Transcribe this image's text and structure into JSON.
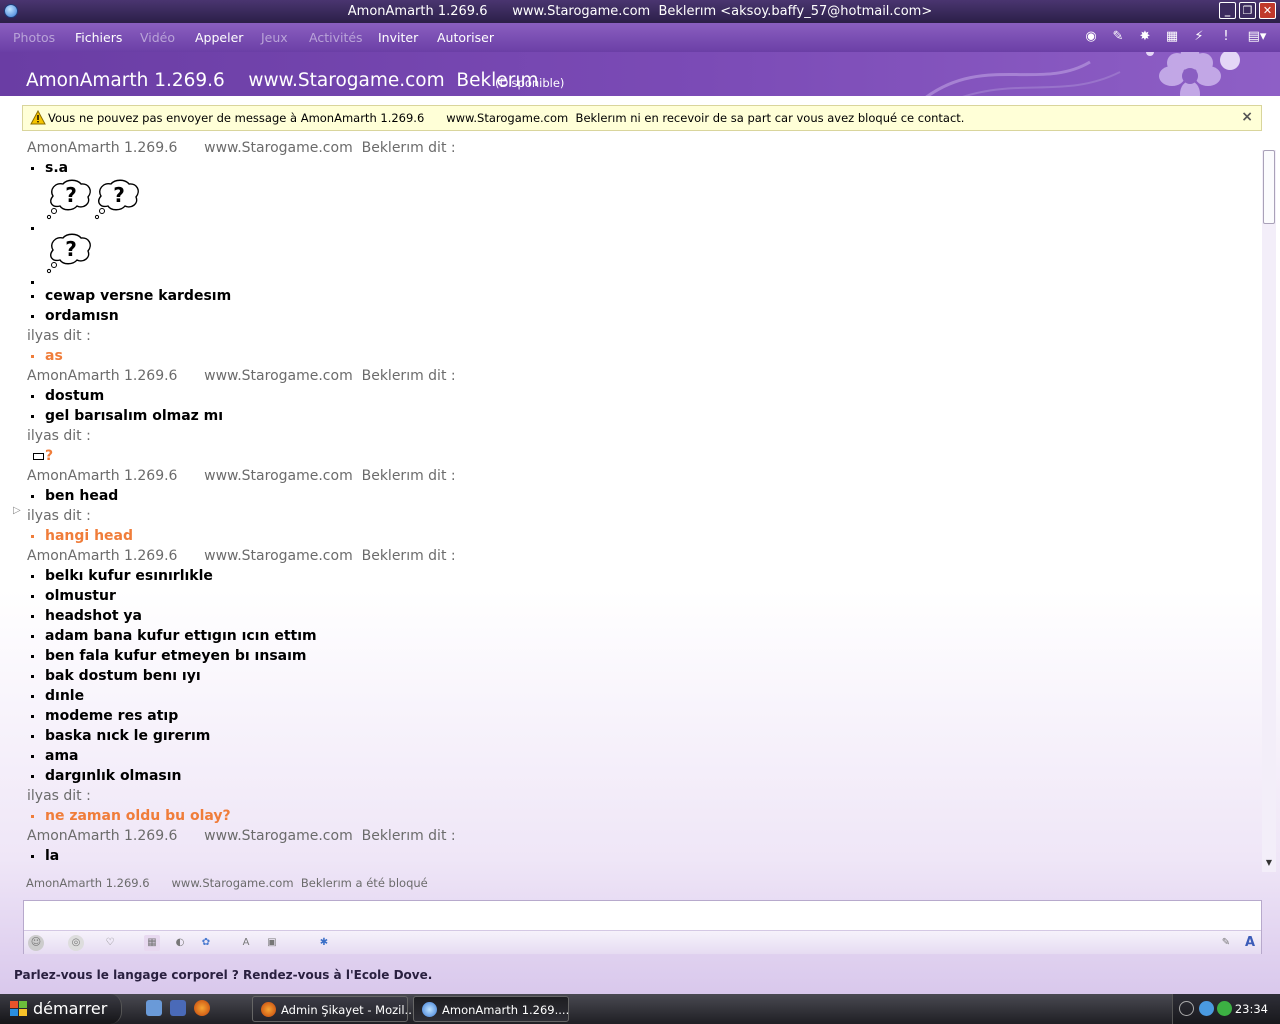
{
  "window": {
    "title": "AmonAmarth 1.269.6      www.Starogame.com  Beklerım <aksoy.baffy_57@hotmail.com>",
    "minimize": "_",
    "maximize": "❐",
    "close": "✕"
  },
  "menu": {
    "items": [
      {
        "label": "Photos",
        "enabled": false
      },
      {
        "label": "Fichiers",
        "enabled": true
      },
      {
        "label": "Vidéo",
        "enabled": false
      },
      {
        "label": "Appeler",
        "enabled": true
      },
      {
        "label": "Jeux",
        "enabled": false
      },
      {
        "label": "Activités",
        "enabled": false
      },
      {
        "label": "Inviter",
        "enabled": true
      },
      {
        "label": "Autoriser",
        "enabled": true
      }
    ],
    "toolbar_icons": [
      "games-icon",
      "paint-icon",
      "wink-icon",
      "phone-icon",
      "nudge-icon",
      "alert-icon",
      "menu-dropdown-icon"
    ]
  },
  "header": {
    "contact_name": "AmonAmarth 1.269.6    www.Starogame.com  Beklerım",
    "status": "(Disponible)"
  },
  "warning": {
    "text": "Vous ne pouvez pas envoyer de message à AmonAmarth 1.269.6      www.Starogame.com  Beklerım ni en recevoir de sa part car vous avez bloqué ce contact.",
    "close": "×"
  },
  "conversation": [
    {
      "type": "sender",
      "text": "AmonAmarth 1.269.6      www.Starogame.com  Beklerım dit :"
    },
    {
      "type": "msg",
      "text": "s.a"
    },
    {
      "type": "emote",
      "count": 2
    },
    {
      "type": "emote",
      "count": 1
    },
    {
      "type": "msg",
      "text": "cewap versne kardesım"
    },
    {
      "type": "msg",
      "text": "ordamısn"
    },
    {
      "type": "sender",
      "text": "ilyas dit :"
    },
    {
      "type": "msg-orange",
      "text": "as"
    },
    {
      "type": "sender",
      "text": "AmonAmarth 1.269.6      www.Starogame.com  Beklerım dit :"
    },
    {
      "type": "msg",
      "text": "dostum"
    },
    {
      "type": "msg",
      "text": "gel barısalım olmaz mı"
    },
    {
      "type": "sender",
      "text": "ilyas dit :"
    },
    {
      "type": "square",
      "text": "?"
    },
    {
      "type": "sender",
      "text": "AmonAmarth 1.269.6      www.Starogame.com  Beklerım dit :"
    },
    {
      "type": "msg",
      "text": "ben head"
    },
    {
      "type": "sender",
      "text": "ilyas dit :"
    },
    {
      "type": "msg-orange",
      "text": "hangi head"
    },
    {
      "type": "sender",
      "text": "AmonAmarth 1.269.6      www.Starogame.com  Beklerım dit :"
    },
    {
      "type": "msg",
      "text": "belkı kufur esınırlıkle"
    },
    {
      "type": "msg",
      "text": "olmustur"
    },
    {
      "type": "msg",
      "text": "headshot ya"
    },
    {
      "type": "msg",
      "text": "adam bana kufur ettıgın ıcın ettım"
    },
    {
      "type": "msg",
      "text": "ben fala kufur etmeyen bı ınsaım"
    },
    {
      "type": "msg",
      "text": "bak dostum benı ıyı"
    },
    {
      "type": "msg",
      "text": "dınle"
    },
    {
      "type": "msg",
      "text": "modeme res atıp"
    },
    {
      "type": "msg",
      "text": "baska nıck le gırerım"
    },
    {
      "type": "msg",
      "text": "ama"
    },
    {
      "type": "msg",
      "text": "dargınlık olmasın"
    },
    {
      "type": "sender",
      "text": "ilyas dit :"
    },
    {
      "type": "msg-orange",
      "text": "ne zaman oldu bu olay?"
    },
    {
      "type": "sender",
      "text": "AmonAmarth 1.269.6      www.Starogame.com  Beklerım dit :"
    },
    {
      "type": "msg",
      "text": "la"
    }
  ],
  "emote_glyph": "?",
  "blocked_note": "AmonAmarth 1.269.6      www.Starogame.com  Beklerım a été bloqué",
  "compose": {
    "placeholder": "",
    "tools": [
      "emoticon-icon",
      "voice-clip-icon",
      "nudge-icon",
      "background-icon",
      "wink-icon",
      "games-icon",
      "handwriting-icon",
      "send-file-icon",
      "settings-icon",
      "pen-icon",
      "font-icon"
    ]
  },
  "ad_text": "Parlez-vous le langage corporel ? Rendez-vous à l'Ecole Dove.",
  "taskbar": {
    "start_label": "démarrer",
    "tasks": [
      {
        "label": "Admin Şikayet - Mozil...",
        "active": false
      },
      {
        "label": "AmonAmarth 1.269....",
        "active": true
      }
    ],
    "clock": "23:34"
  }
}
